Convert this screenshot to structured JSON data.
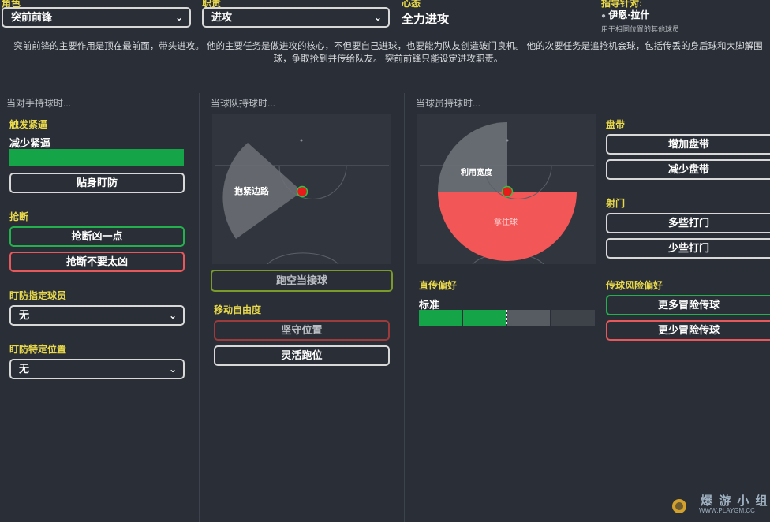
{
  "header": {
    "role_label": "角色",
    "role_value": "突前前锋",
    "duty_label": "职责",
    "duty_value": "进攻",
    "mentality_label": "心态",
    "mentality_value": "全力进攻",
    "instr_label": "指导针对:",
    "instr_player": "伊恩·拉什",
    "instr_sub": "用于相同位置的其他球员",
    "description": "突前前锋的主要作用是顶在最前面，带头进攻。 他的主要任务是做进攻的核心，不但要自己进球，也要能为队友创造破门良机。 他的次要任务是追抢机会球，包括传丢的身后球和大脚解围球，争取抢到并传给队友。 突前前锋只能设定进攻职责。"
  },
  "col1": {
    "title": "当对手持球时...",
    "press_label": "触发紧逼",
    "press_value": "减少紧逼",
    "tight_btn": "贴身盯防",
    "tackle_label": "抢断",
    "tackle_more": "抢断凶一点",
    "tackle_less": "抢断不要太凶",
    "mark_player_label": "盯防指定球员",
    "mark_player_value": "无",
    "mark_pos_label": "盯防特定位置",
    "mark_pos_value": "无"
  },
  "col2": {
    "title": "当球队持球时...",
    "zone_label": "抱紧边路",
    "get_further_btn": "跑空当接球",
    "freedom_label": "移动自由度",
    "hold_btn": "坚守位置",
    "roam_btn": "灵活跑位"
  },
  "col3": {
    "title": "当球员持球时...",
    "width_label": "利用宽度",
    "hold_ball_label": "拿住球",
    "direct_label": "直传偏好",
    "direct_value": "标准",
    "direct_level": 0.5
  },
  "col4": {
    "dribble_label": "盘带",
    "dribble_more": "增加盘带",
    "dribble_less": "减少盘带",
    "shoot_label": "射门",
    "shoot_more": "多些打门",
    "shoot_less": "少些打门",
    "risk_label": "传球风险偏好",
    "risk_more": "更多冒险传球",
    "risk_less": "更少冒险传球"
  },
  "watermark": {
    "name": "爆 游 小 组",
    "url": "WWW.PLAYGM.CC"
  },
  "colors": {
    "yellow": "#e9d94a",
    "green": "#22b14c",
    "red": "#e8575a",
    "bg": "#2a2f37"
  }
}
